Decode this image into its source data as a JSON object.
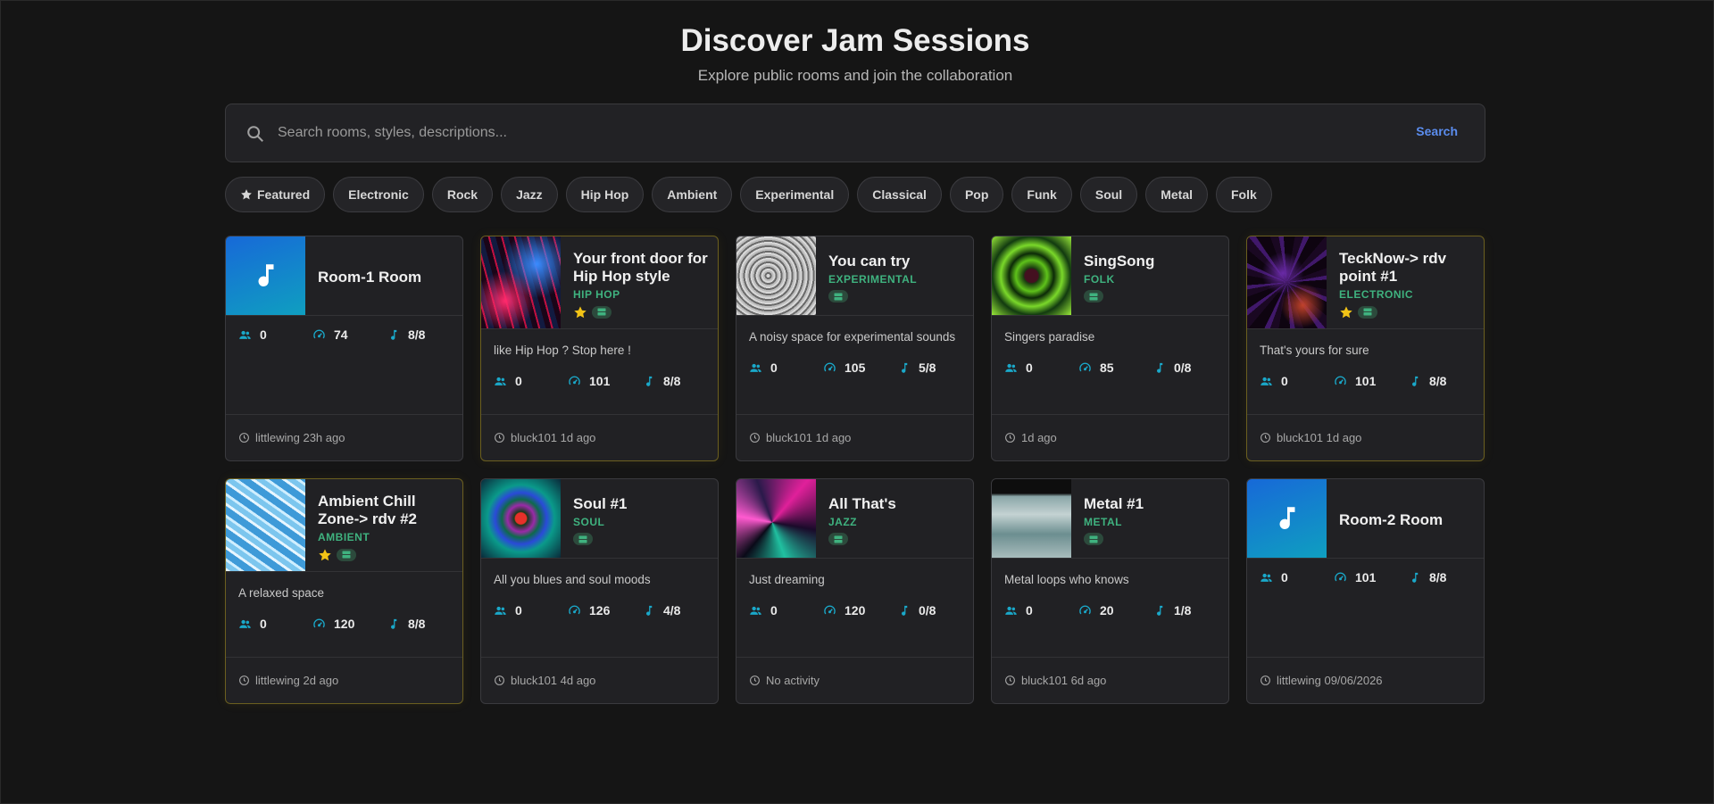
{
  "page": {
    "title": "Discover Jam Sessions",
    "subtitle": "Explore public rooms and join the collaboration"
  },
  "search": {
    "placeholder": "Search rooms, styles, descriptions...",
    "button_label": "Search"
  },
  "filters": [
    "Featured",
    "Electronic",
    "Rock",
    "Jazz",
    "Hip Hop",
    "Ambient",
    "Experimental",
    "Classical",
    "Pop",
    "Funk",
    "Soul",
    "Metal",
    "Folk"
  ],
  "colors": {
    "accent": "#5b8def",
    "genre": "#3fb27f",
    "stat_icon": "#1aa8c9",
    "featured_border": "#6b5f1f",
    "star": "#f2c316"
  },
  "rooms": [
    {
      "title": "Room-1 Room",
      "genre": "",
      "thumb": "music-icon",
      "featured": false,
      "server": false,
      "description": "",
      "users": "0",
      "bpm": "74",
      "tracks": "8/8",
      "activity": "littlewing 23h ago"
    },
    {
      "title": "Your front door for Hip Hop style",
      "genre": "HIP HOP",
      "thumb": "neon-art",
      "featured": true,
      "server": true,
      "description": "like Hip Hop ? Stop here !",
      "users": "0",
      "bpm": "101",
      "tracks": "8/8",
      "activity": "bluck101 1d ago"
    },
    {
      "title": "You can try",
      "genre": "EXPERIMENTAL",
      "thumb": "noise-art",
      "featured": false,
      "server": true,
      "description": "A noisy space for experimental sounds",
      "users": "0",
      "bpm": "105",
      "tracks": "5/8",
      "activity": "bluck101 1d ago"
    },
    {
      "title": "SingSong",
      "genre": "FOLK",
      "thumb": "green-art",
      "featured": false,
      "server": true,
      "description": "Singers paradise",
      "users": "0",
      "bpm": "85",
      "tracks": "0/8",
      "activity": "1d ago"
    },
    {
      "title": "TeckNow-> rdv point #1",
      "genre": "ELECTRONIC",
      "thumb": "purple-art",
      "featured": true,
      "server": true,
      "description": "That's yours for sure",
      "users": "0",
      "bpm": "101",
      "tracks": "8/8",
      "activity": "bluck101 1d ago"
    },
    {
      "title": "Ambient Chill Zone-> rdv #2",
      "genre": "AMBIENT",
      "thumb": "ice-art",
      "featured": true,
      "server": true,
      "description": "A relaxed space",
      "users": "0",
      "bpm": "120",
      "tracks": "8/8",
      "activity": "littlewing 2d ago"
    },
    {
      "title": "Soul #1",
      "genre": "SOUL",
      "thumb": "mandala-art",
      "featured": false,
      "server": true,
      "description": "All you blues and soul moods",
      "users": "0",
      "bpm": "126",
      "tracks": "4/8",
      "activity": "bluck101 4d ago"
    },
    {
      "title": "All That's",
      "genre": "JAZZ",
      "thumb": "swirl-art",
      "featured": false,
      "server": true,
      "description": "Just dreaming",
      "users": "0",
      "bpm": "120",
      "tracks": "0/8",
      "activity": "No activity"
    },
    {
      "title": "Metal #1",
      "genre": "METAL",
      "thumb": "wave-art",
      "featured": false,
      "server": true,
      "description": "Metal loops who knows",
      "users": "0",
      "bpm": "20",
      "tracks": "1/8",
      "activity": "bluck101 6d ago"
    },
    {
      "title": "Room-2 Room",
      "genre": "",
      "thumb": "music-icon",
      "featured": false,
      "server": false,
      "description": "",
      "users": "0",
      "bpm": "101",
      "tracks": "8/8",
      "activity": "littlewing 09/06/2026"
    }
  ]
}
